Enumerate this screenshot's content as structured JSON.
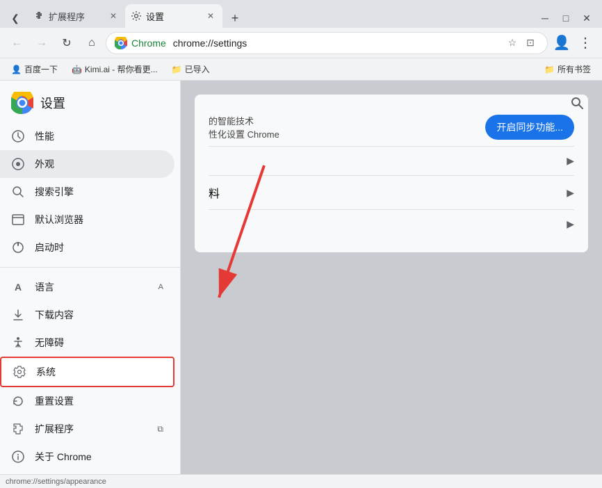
{
  "window": {
    "minimize": "─",
    "maximize": "□",
    "close": "✕"
  },
  "tabs": [
    {
      "id": "extensions",
      "favicon": "puzzle",
      "title": "扩展程序",
      "active": false
    },
    {
      "id": "settings",
      "favicon": "gear",
      "title": "设置",
      "active": true
    }
  ],
  "newTabBtn": "+",
  "nav": {
    "back": "←",
    "forward": "→",
    "reload": "↻",
    "home": "⌂",
    "addressIcon": "Chrome",
    "addressText": "chrome://settings",
    "star": "☆",
    "readingList": "📋",
    "profile": "👤",
    "menu": "⋮"
  },
  "bookmarks": [
    {
      "icon": "👤",
      "label": "百度一下"
    },
    {
      "icon": "🤖",
      "label": "Kimi.ai - 帮你看更..."
    },
    {
      "icon": "📁",
      "label": "已导入"
    }
  ],
  "bookmarksRight": "所有书签",
  "sidebar": {
    "title": "设置",
    "items": [
      {
        "id": "performance",
        "icon": "⚙",
        "label": "性能"
      },
      {
        "id": "appearance",
        "icon": "👁",
        "label": "外观",
        "active": true
      },
      {
        "id": "search",
        "icon": "🔍",
        "label": "搜索引擎"
      },
      {
        "id": "browser",
        "icon": "⬜",
        "label": "默认浏览器"
      },
      {
        "id": "startup",
        "icon": "⏻",
        "label": "启动时"
      },
      {
        "id": "language",
        "icon": "A",
        "label": "语言"
      },
      {
        "id": "downloads",
        "icon": "↓",
        "label": "下载内容"
      },
      {
        "id": "accessibility",
        "icon": "♿",
        "label": "无障碍"
      },
      {
        "id": "system",
        "icon": "🔧",
        "label": "系统",
        "highlighted": true
      },
      {
        "id": "reset",
        "icon": "↺",
        "label": "重置设置"
      },
      {
        "id": "extensions",
        "icon": "🧩",
        "label": "扩展程序"
      },
      {
        "id": "about",
        "icon": "⓪",
        "label": "关于 Chrome"
      }
    ]
  },
  "content": {
    "searchIcon": "🔍",
    "card": {
      "syncText": "的智能技术",
      "personalizeText": "性化设置 Chrome",
      "syncBtn": "开启同步功能...",
      "rows": [
        {
          "hasChevron": true
        },
        {
          "label": "料",
          "hasChevron": true
        },
        {
          "hasChevron": true
        }
      ]
    }
  },
  "statusBar": {
    "url": "chrome://settings/appearance"
  },
  "annotation": {
    "arrowColor": "#e53935"
  }
}
